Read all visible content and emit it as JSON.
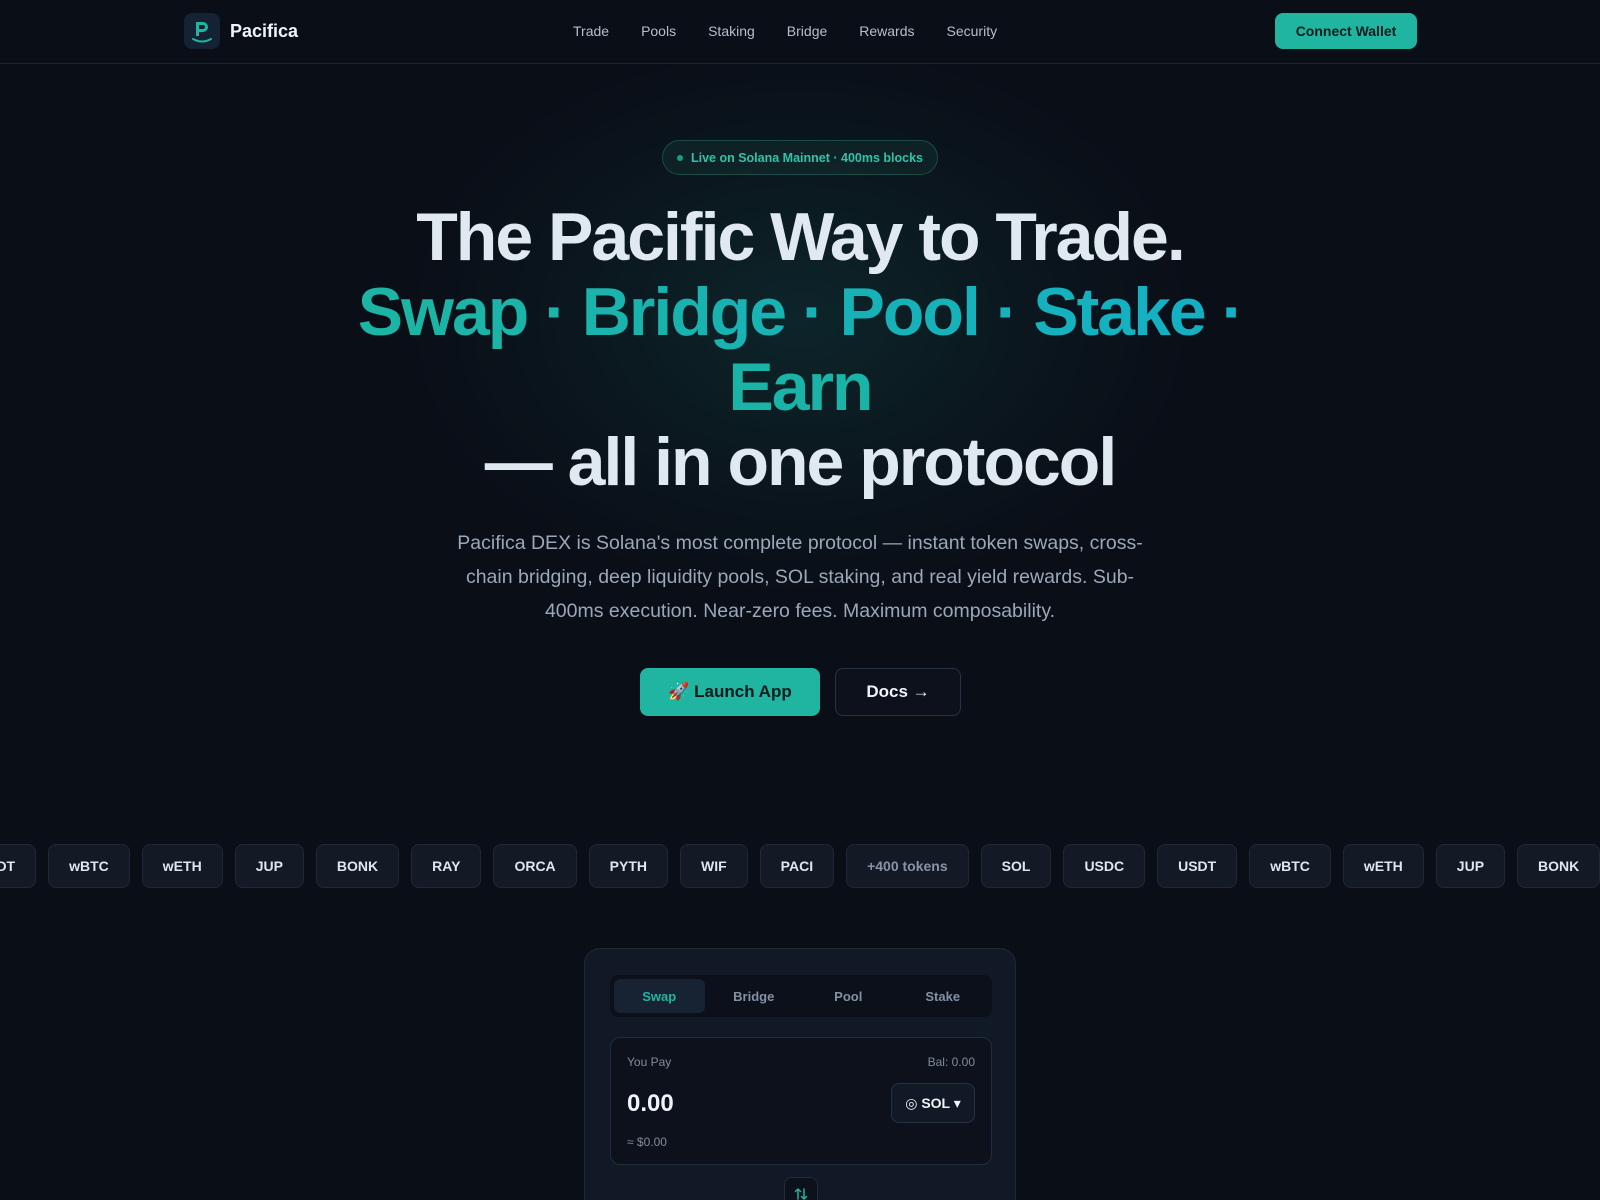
{
  "nav": {
    "brand": "Pacifica",
    "links": [
      "Trade",
      "Pools",
      "Staking",
      "Bridge",
      "Rewards",
      "Security"
    ],
    "connect_label": "Connect Wallet"
  },
  "hero": {
    "badge": "Live on Solana Mainnet · 400ms blocks",
    "line1": "The Pacific Way to Trade.",
    "line2": "Swap · Bridge · Pool · Stake ·",
    "line3": "Earn",
    "line4": "— all in one protocol",
    "subtitle": "Pacifica DEX is Solana's most complete protocol — instant token swaps, cross-chain bridging, deep liquidity pools, SOL staking, and real yield rewards. Sub-400ms execution. Near-zero fees. Maximum composability.",
    "launch_label": "🚀 Launch App",
    "docs_label": "Docs →"
  },
  "tokens": [
    "USDT",
    "wBTC",
    "wETH",
    "JUP",
    "BONK",
    "RAY",
    "ORCA",
    "PYTH",
    "WIF",
    "PACI",
    "+400 tokens",
    "SOL",
    "USDC",
    "USDT",
    "wBTC",
    "wETH",
    "JUP",
    "BONK"
  ],
  "swap": {
    "tabs": [
      "Swap",
      "Bridge",
      "Pool",
      "Stake"
    ],
    "active_tab": "Swap",
    "pay_label": "You Pay",
    "balance": "Bal: 0.00",
    "amount": "0.00",
    "usd_value": "≈ $0.00",
    "token": "◎ SOL ▾"
  },
  "colors": {
    "accent": "#1fb5a0",
    "background": "#0a0e17",
    "card": "#121926"
  }
}
